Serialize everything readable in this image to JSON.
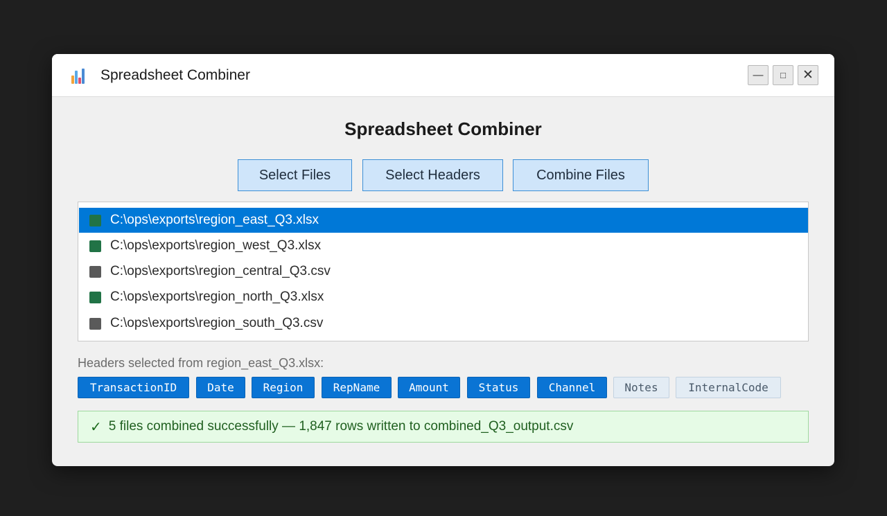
{
  "window": {
    "title": "Spreadsheet Combiner",
    "icon": "bar-chart-app-icon",
    "controls": [
      "minimize",
      "maximize",
      "close"
    ]
  },
  "main": {
    "heading": "Spreadsheet Combiner",
    "buttons": {
      "select_files": "Select Files",
      "select_headers": "Select Headers",
      "combine_files": "Combine Files"
    }
  },
  "files": [
    {
      "path": "C:\\ops\\exports\\region_east_Q3.xlsx",
      "type": "xlsx",
      "selected": true
    },
    {
      "path": "C:\\ops\\exports\\region_west_Q3.xlsx",
      "type": "xlsx",
      "selected": false
    },
    {
      "path": "C:\\ops\\exports\\region_central_Q3.csv",
      "type": "csv",
      "selected": false
    },
    {
      "path": "C:\\ops\\exports\\region_north_Q3.xlsx",
      "type": "xlsx",
      "selected": false
    },
    {
      "path": "C:\\ops\\exports\\region_south_Q3.csv",
      "type": "csv",
      "selected": false
    }
  ],
  "headers": {
    "label": "Headers selected from region_east_Q3.xlsx:",
    "items": [
      {
        "name": "TransactionID",
        "selected": true
      },
      {
        "name": "Date",
        "selected": true
      },
      {
        "name": "Region",
        "selected": true
      },
      {
        "name": "RepName",
        "selected": true
      },
      {
        "name": "Amount",
        "selected": true
      },
      {
        "name": "Status",
        "selected": true
      },
      {
        "name": "Channel",
        "selected": true
      },
      {
        "name": "Notes",
        "selected": false
      },
      {
        "name": "InternalCode",
        "selected": false
      }
    ]
  },
  "status": {
    "icon": "checkmark-icon",
    "text": "5 files combined successfully — 1,847 rows written to combined_Q3_output.csv"
  },
  "colors": {
    "accent": "#0078d7",
    "xlsx_icon": "#217346",
    "csv_icon": "#5a5a5a",
    "success_bg": "#e6fbe6",
    "success_text": "#1f5f1f"
  }
}
